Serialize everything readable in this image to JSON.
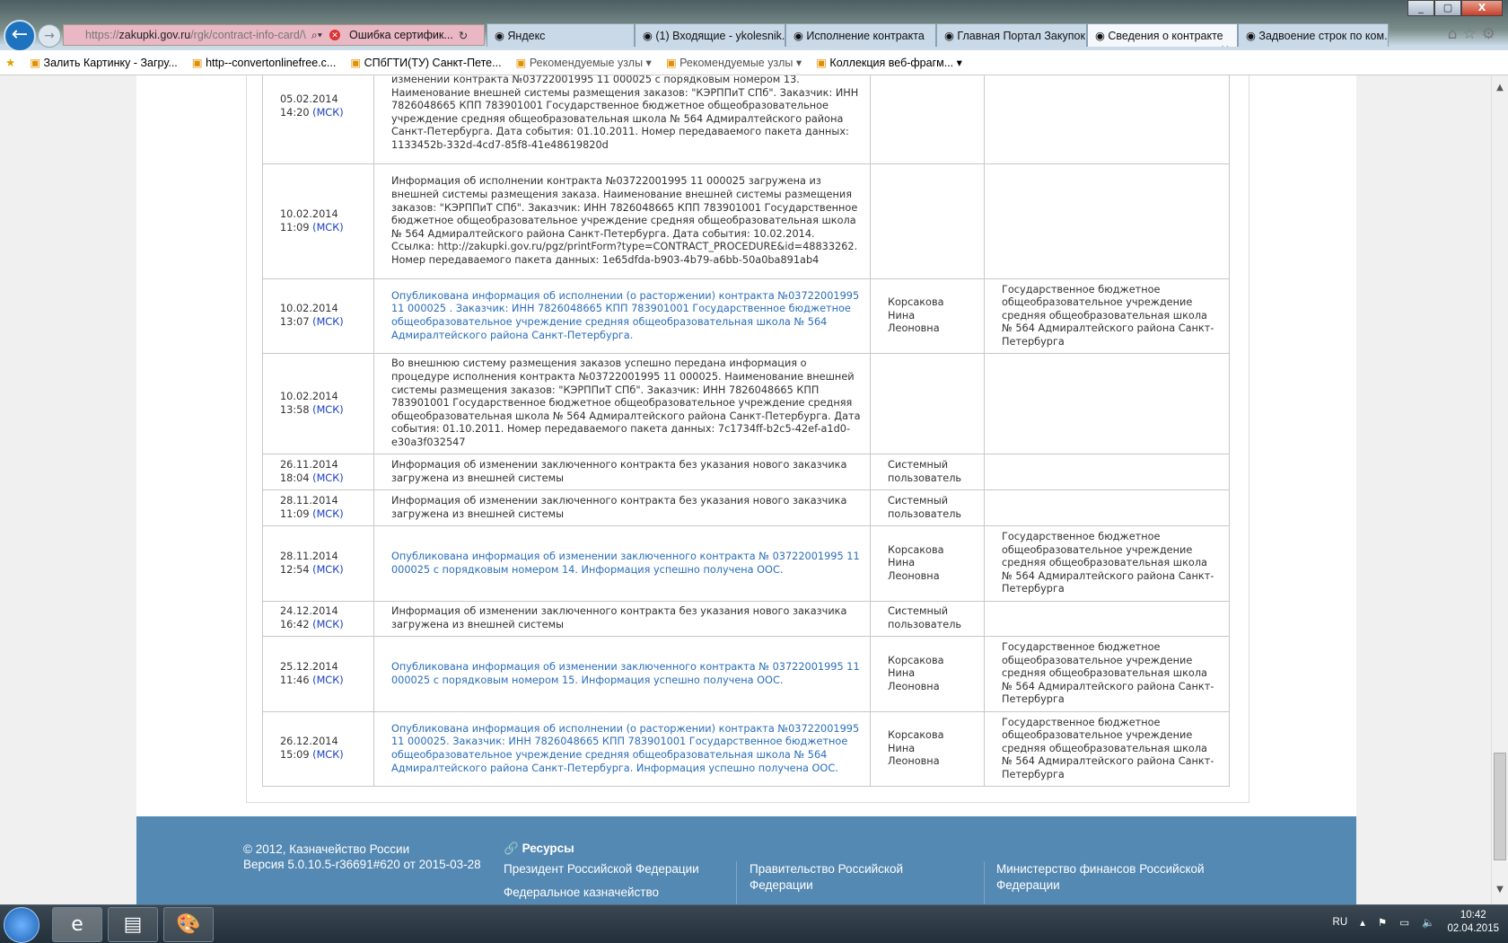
{
  "browser": {
    "url_host": "zakupki.gov.ru",
    "url_prefix": "https://",
    "url_path": "/rgk/contract-info-card/\\",
    "cert_error": "Ошибка сертифик...",
    "tabs": [
      {
        "label": "Яндекс"
      },
      {
        "label": "(1) Входящие - ykolesnik..."
      },
      {
        "label": "Исполнение контракта"
      },
      {
        "label": "Главная Портал Закупок"
      },
      {
        "label": "Сведения о контракте"
      },
      {
        "label": "Задвоение строк по ком..."
      }
    ],
    "active_tab": 4,
    "favorites": [
      "Залить Картинку - Загру...",
      "http--convertonlinefree.c...",
      "СПбГТИ(ТУ) Санкт-Пете...",
      "Рекомендуемые узлы",
      "Рекомендуемые узлы",
      "Коллекция веб-фрагм..."
    ]
  },
  "table": {
    "rows": [
      {
        "date": "05.02.2014",
        "time": "14:20",
        "tz": "(МСК)",
        "text": "Во внешнюю систему размещения заказов успешно передана информация об изменении контракта №03722001995 11 000025 с порядковым номером 13. Наименование внешней системы размещения заказов: \"КЭРППиТ СПб\". Заказчик: ИНН 7826048665 КПП 783901001 Государственное бюджетное общеобразовательное учреждение средняя общеобразовательная школа № 564 Адмиралтейского района Санкт-Петербурга. Дата события: 01.10.2011. Номер передаваемого пакета данных: 1133452b-332d-4cd7-85f8-41e48619820d",
        "link": false,
        "user": "",
        "org": ""
      },
      {
        "date": "10.02.2014",
        "time": "11:09",
        "tz": "(МСК)",
        "text": "Информация об исполнении контракта №03722001995 11 000025 загружена из внешней системы размещения заказа. Наименование внешней системы размещения заказов: \"КЭРППиТ СПб\". Заказчик: ИНН 7826048665 КПП 783901001 Государственное бюджетное общеобразовательное учреждение средняя общеобразовательная школа № 564 Адмиралтейского района Санкт-Петербурга. Дата события: 10.02.2014. Ссылка: http://zakupki.gov.ru/pgz/printForm?type=CONTRACT_PROCEDURE&id=48833262. Номер передаваемого пакета данных: 1e65dfda-b903-4b79-a6bb-50a0ba891ab4",
        "link": false,
        "user": "",
        "org": ""
      },
      {
        "date": "10.02.2014",
        "time": "13:07",
        "tz": "(МСК)",
        "text": "Опубликована информация об исполнении (о расторжении) контракта №03722001995 11 000025 . Заказчик: ИНН 7826048665 КПП 783901001 Государственное бюджетное общеобразовательное учреждение средняя общеобразовательная школа № 564 Адмиралтейского района Санкт-Петербурга.",
        "link": true,
        "user": "Корсакова Нина Леоновна",
        "org": "Государственное бюджетное общеобразовательное учреждение средняя общеобразовательная школа № 564 Адмиралтейского района Санкт-Петербурга"
      },
      {
        "date": "10.02.2014",
        "time": "13:58",
        "tz": "(МСК)",
        "text": "Во внешнюю систему размещения заказов успешно передана информация о процедуре исполнения контракта №03722001995 11 000025. Наименование внешней системы размещения заказов: \"КЭРППиТ СПб\". Заказчик: ИНН 7826048665 КПП 783901001 Государственное бюджетное общеобразовательное учреждение средняя общеобразовательная школа № 564 Адмиралтейского района Санкт-Петербурга. Дата события: 01.10.2011. Номер передаваемого пакета данных: 7c1734ff-b2c5-42ef-a1d0-e30a3f032547",
        "link": false,
        "user": "",
        "org": ""
      },
      {
        "date": "26.11.2014",
        "time": "18:04",
        "tz": "(МСК)",
        "text": "Информация об изменении заключенного контракта без указания нового заказчика загружена из внешней системы",
        "link": false,
        "user": "Системный пользователь",
        "org": ""
      },
      {
        "date": "28.11.2014",
        "time": "11:09",
        "tz": "(МСК)",
        "text": "Информация об изменении заключенного контракта без указания нового заказчика загружена из внешней системы",
        "link": false,
        "user": "Системный пользователь",
        "org": ""
      },
      {
        "date": "28.11.2014",
        "time": "12:54",
        "tz": "(МСК)",
        "text": "Опубликована информация об изменении заключенного контракта № 03722001995 11 000025 с порядковым номером 14. Информация успешно получена ООС.",
        "link": true,
        "user": "Корсакова Нина Леоновна",
        "org": "Государственное бюджетное общеобразовательное учреждение средняя общеобразовательная школа № 564 Адмиралтейского района Санкт-Петербурга"
      },
      {
        "date": "24.12.2014",
        "time": "16:42",
        "tz": "(МСК)",
        "text": "Информация об изменении заключенного контракта без указания нового заказчика загружена из внешней системы",
        "link": false,
        "user": "Системный пользователь",
        "org": ""
      },
      {
        "date": "25.12.2014",
        "time": "11:46",
        "tz": "(МСК)",
        "text": "Опубликована информация об изменении заключенного контракта № 03722001995 11 000025 с порядковым номером 15. Информация успешно получена ООС.",
        "link": true,
        "user": "Корсакова Нина Леоновна",
        "org": "Государственное бюджетное общеобразовательное учреждение средняя общеобразовательная школа № 564 Адмиралтейского района Санкт-Петербурга"
      },
      {
        "date": "26.12.2014",
        "time": "15:09",
        "tz": "(МСК)",
        "text": "Опубликована информация об исполнении (о расторжении) контракта №03722001995 11 000025. Заказчик: ИНН 7826048665 КПП 783901001 Государственное бюджетное общеобразовательное учреждение средняя общеобразовательная школа № 564 Адмиралтейского района Санкт-Петербурга. Информация успешно получена ООС.",
        "link": true,
        "user": "Корсакова Нина Леоновна",
        "org": "Государственное бюджетное общеобразовательное учреждение средняя общеобразовательная школа № 564 Адмиралтейского района Санкт-Петербурга"
      }
    ]
  },
  "footer": {
    "copyright": "© 2012, Казначейство России",
    "version": "Версия 5.0.10.5-r36691#620 от 2015-03-28",
    "resources_title": "Ресурсы",
    "links": [
      "Президент Российской Федерации",
      "Федеральное казначейство",
      "Правительство Российской Федерации",
      "Министерство финансов Российской Федерации"
    ]
  },
  "taskbar": {
    "lang": "RU",
    "time": "10:42",
    "date": "02.04.2015"
  }
}
